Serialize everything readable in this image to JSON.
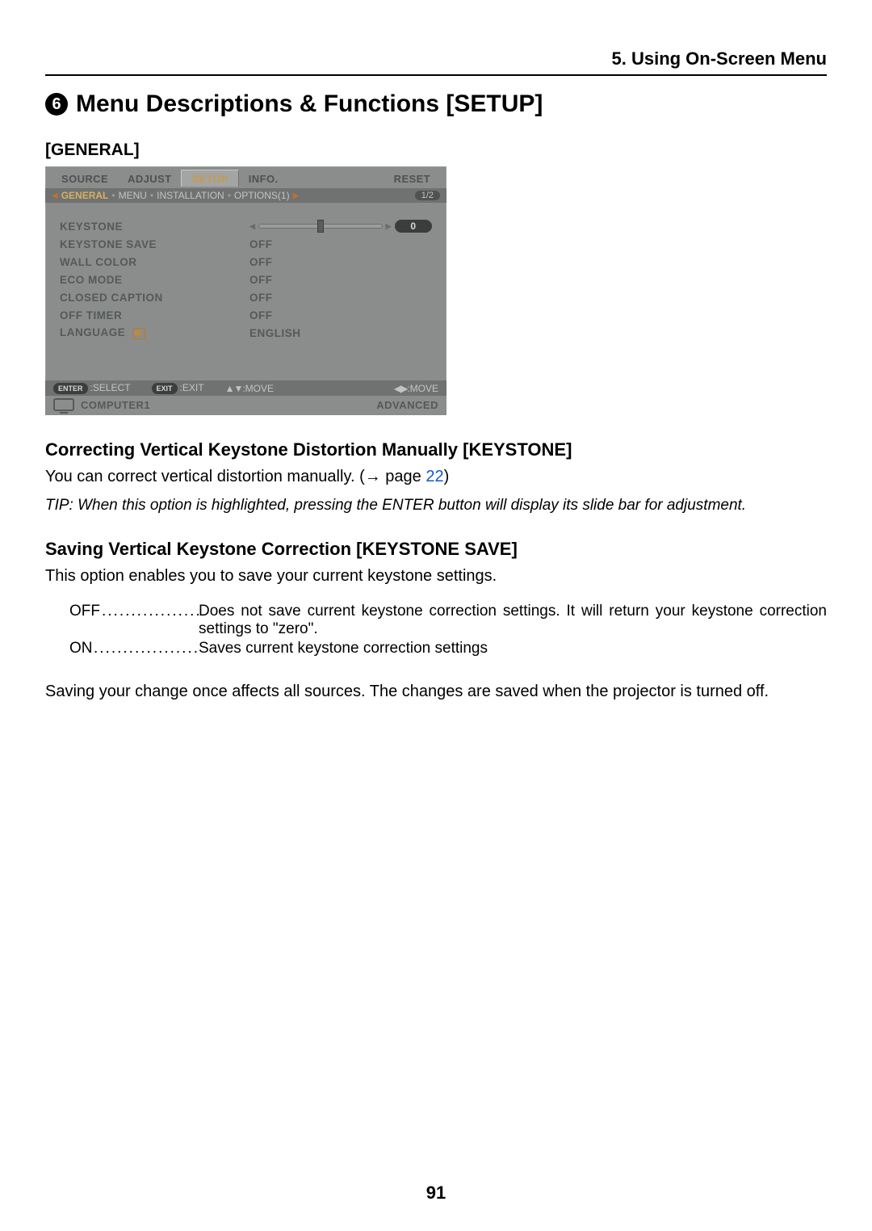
{
  "chapter": "5. Using On-Screen Menu",
  "section_number": "6",
  "section_title": "Menu Descriptions & Functions [SETUP]",
  "general_label": "[GENERAL]",
  "osd": {
    "tabs": [
      "SOURCE",
      "ADJUST",
      "SETUP",
      "INFO.",
      "RESET"
    ],
    "subtabs": [
      "GENERAL",
      "MENU",
      "INSTALLATION",
      "OPTIONS(1)"
    ],
    "page_indicator": "1/2",
    "rows": {
      "keystone": "KEYSTONE",
      "keystone_save": "KEYSTONE SAVE",
      "wall_color": "WALL COLOR",
      "eco_mode": "ECO MODE",
      "closed_caption": "CLOSED CAPTION",
      "off_timer": "OFF TIMER",
      "language": "LANGUAGE"
    },
    "values": {
      "keystone_slider": "0",
      "keystone_save": "OFF",
      "wall_color": "OFF",
      "eco_mode": "OFF",
      "closed_caption": "OFF",
      "off_timer": "OFF",
      "language": "ENGLISH"
    },
    "hints": {
      "enter_pill": "ENTER",
      "enter": ":SELECT",
      "exit_pill": "EXIT",
      "exit": ":EXIT",
      "move_v": ":MOVE",
      "move_h": ":MOVE"
    },
    "status": {
      "source": "COMPUTER1",
      "mode": "ADVANCED"
    }
  },
  "h_keystone": "Correcting Vertical Keystone Distortion Manually [KEYSTONE]",
  "p_keystone_a": "You can correct vertical distortion manually. (→ page ",
  "p_keystone_link": "22",
  "p_keystone_b": ")",
  "tip": "TIP: When this option is highlighted, pressing the ENTER button will display its slide bar for adjustment.",
  "h_keystonesave": "Saving Vertical Keystone Correction [KEYSTONE SAVE]",
  "p_keystonesave": "This option enables you to save your current keystone settings.",
  "defs": {
    "off_term": "OFF",
    "off_desc": "Does not save current keystone correction settings. It will return your keystone correction settings to \"zero\".",
    "on_term": "ON",
    "on_desc": "Saves current keystone correction settings"
  },
  "p_saving": "Saving your change once affects all sources. The changes are saved when the projector is turned off.",
  "page_number": "91"
}
